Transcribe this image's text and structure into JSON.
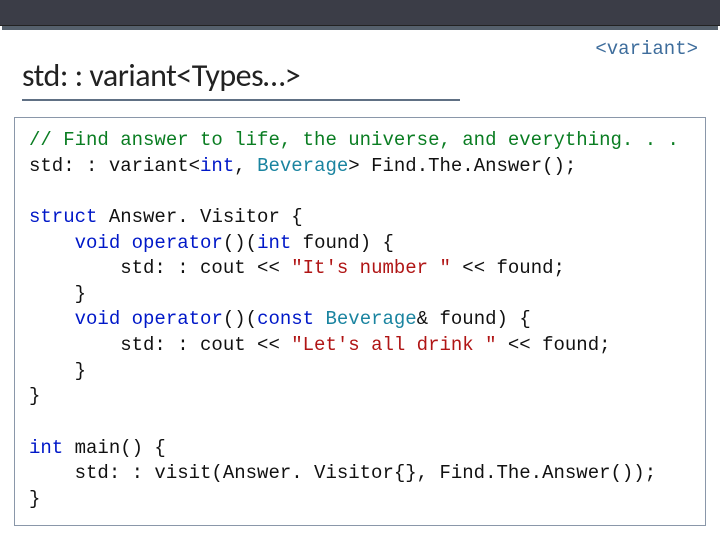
{
  "header": {
    "tag": "<variant>",
    "title": "std: : variant<Types…>"
  },
  "code": {
    "line1_comment": "// Find answer to life, the universe, and everything. . .",
    "line2_a": "std: : variant<",
    "line2_int": "int",
    "line2_b": ", ",
    "line2_bev": "Beverage",
    "line2_c": "> Find.The.Answer();",
    "struct_kw": "struct",
    "struct_name": " Answer. Visitor {",
    "v1_a": "void",
    "v1_b": " ",
    "v1_c": "operator",
    "v1_d": "()(",
    "v1_e": "int",
    "v1_f": " found) {",
    "out1_a": "        std: : cout << ",
    "out1_str": "\"It's number \"",
    "out1_b": " << found;",
    "brace_close_inner": "    }",
    "v2_a": "void",
    "v2_b": " ",
    "v2_c": "operator",
    "v2_d": "()(",
    "v2_e": "const",
    "v2_f": " ",
    "v2_g": "Beverage",
    "v2_h": "& found) {",
    "out2_a": "        std: : cout << ",
    "out2_str": "\"Let's all drink \"",
    "out2_b": " << found;",
    "brace_close_outer": "}",
    "main_a": "int",
    "main_b": " main() {",
    "visit": "    std: : visit(Answer. Visitor{}, Find.The.Answer());"
  }
}
